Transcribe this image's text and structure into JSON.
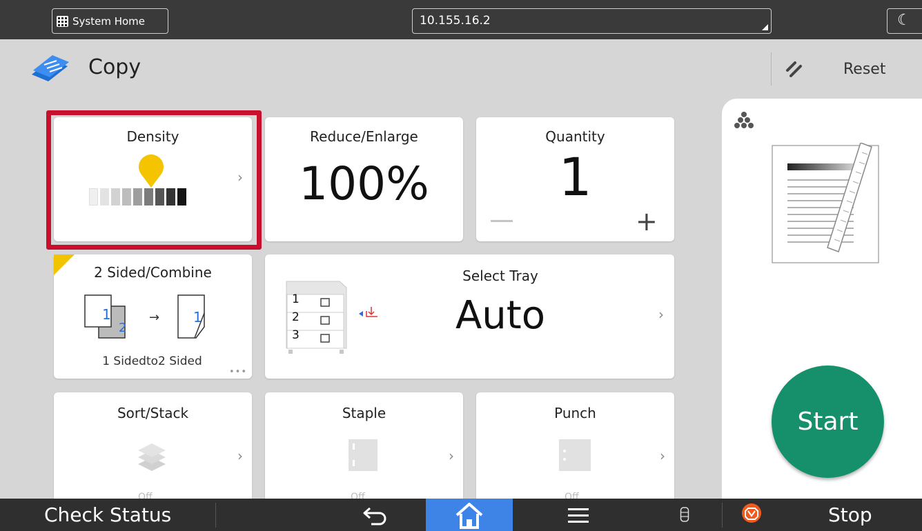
{
  "topbar": {
    "system_home_label": "System Home",
    "address": "10.155.16.2",
    "moon_glyph": "☾"
  },
  "header": {
    "title": "Copy",
    "reset_label": "Reset"
  },
  "tiles": {
    "density": {
      "title": "Density",
      "level": 6,
      "levels": 9
    },
    "reduce_enlarge": {
      "title": "Reduce/Enlarge",
      "value": "100%"
    },
    "quantity": {
      "title": "Quantity",
      "value": "1"
    },
    "two_sided": {
      "title": "2 Sided/Combine",
      "subtitle": "1 Sidedto2 Sided",
      "page_a": "1",
      "page_b": "2",
      "page_c": "1"
    },
    "select_tray": {
      "title": "Select Tray",
      "value": "Auto",
      "trays": [
        "1",
        "2",
        "3"
      ]
    },
    "sort_stack": {
      "title": "Sort/Stack",
      "status": "Off"
    },
    "staple": {
      "title": "Staple",
      "status": "Off"
    },
    "punch": {
      "title": "Punch",
      "status": "Off"
    }
  },
  "right_panel": {
    "start_label": "Start"
  },
  "bottombar": {
    "check_status_label": "Check Status",
    "stop_label": "Stop"
  },
  "colors": {
    "accent_start": "#15906a",
    "home_blue": "#3d84e6",
    "highlight_red": "#c8102e",
    "density_pin": "#f5c400"
  },
  "icons": [
    "grid-icon",
    "copy-icon",
    "reset-icon",
    "density-pin-icon",
    "paper-stack-icon",
    "staple-icon",
    "punch-icon",
    "back-arrow-icon",
    "home-icon",
    "menu-icon",
    "storage-icon",
    "stop-icon"
  ]
}
